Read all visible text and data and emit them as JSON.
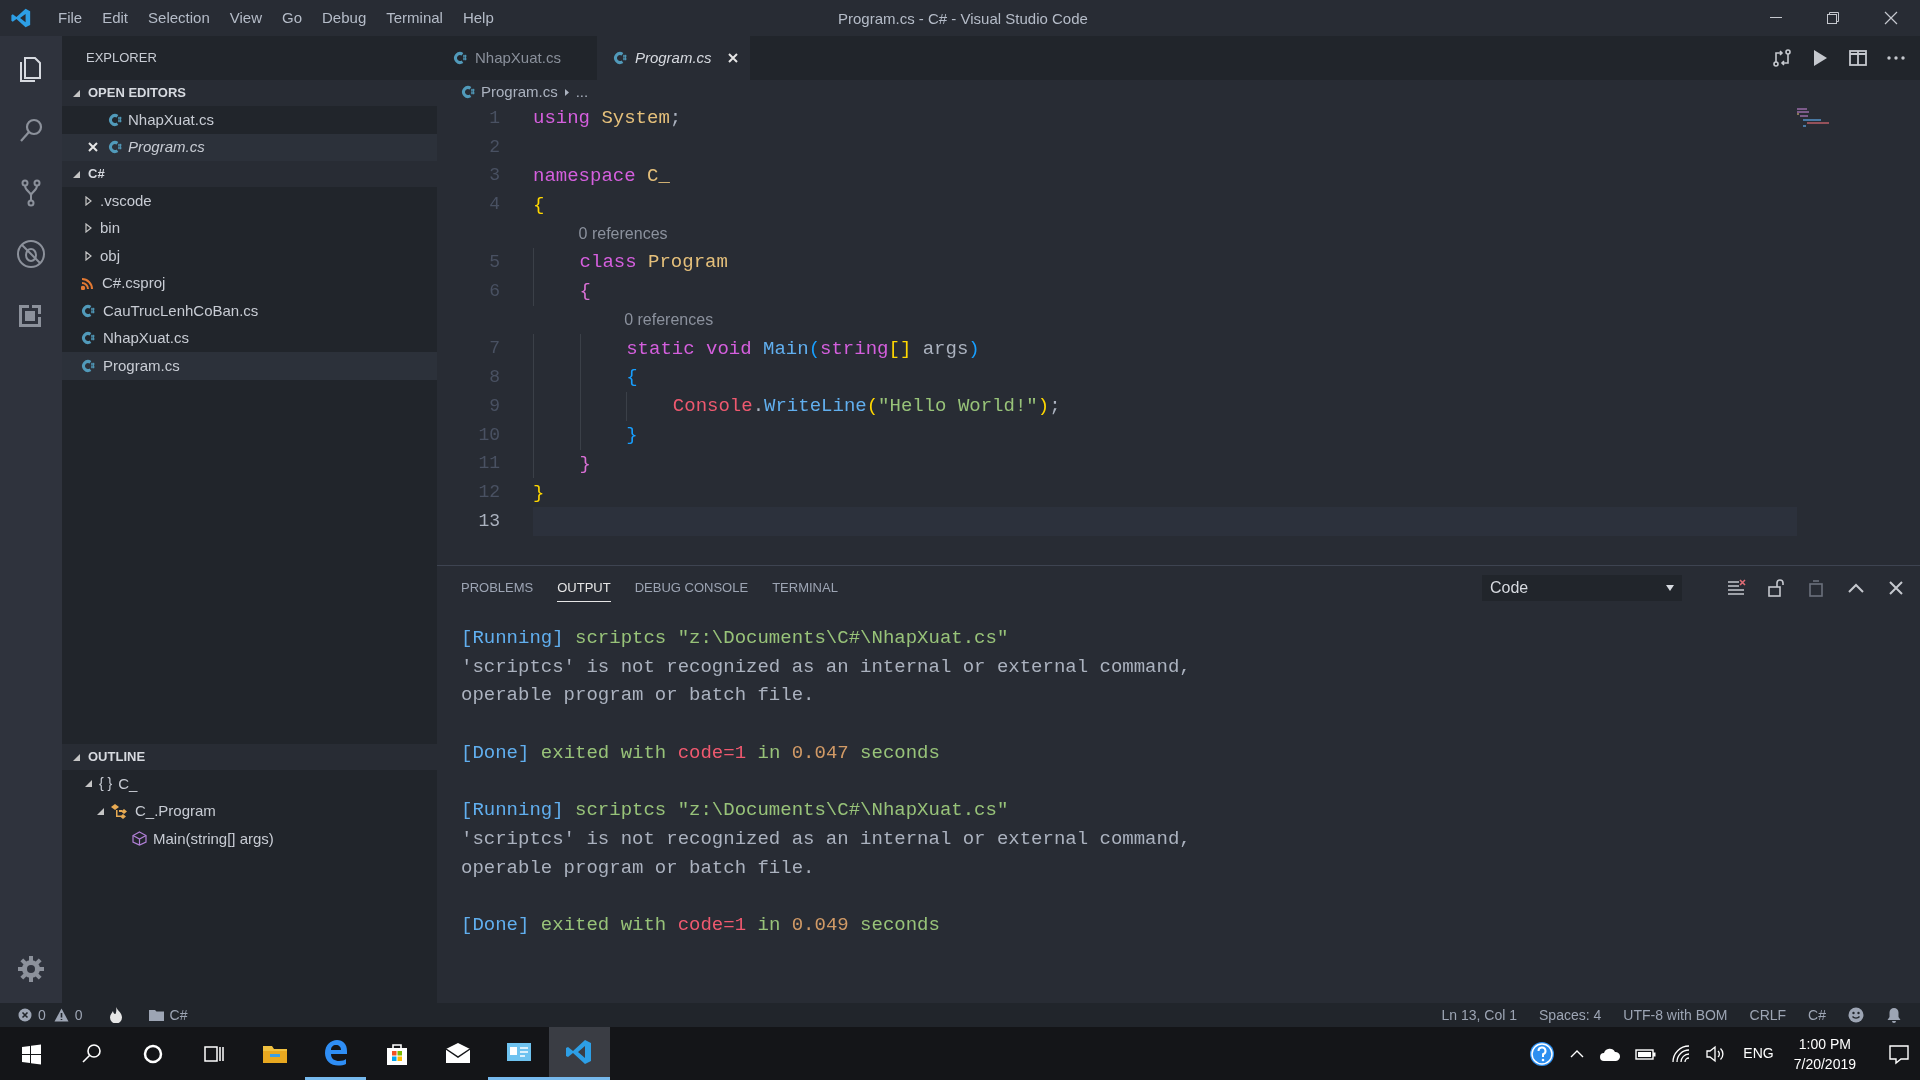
{
  "title_bar": {
    "menu": [
      "File",
      "Edit",
      "Selection",
      "View",
      "Go",
      "Debug",
      "Terminal",
      "Help"
    ],
    "title": "Program.cs - C# - Visual Studio Code"
  },
  "activity_bar": {
    "items": [
      {
        "kind": "files",
        "selected": true
      },
      {
        "kind": "search",
        "selected": false
      },
      {
        "kind": "source-control",
        "selected": false
      },
      {
        "kind": "debug",
        "selected": false
      },
      {
        "kind": "extensions",
        "selected": false
      }
    ]
  },
  "sidebar": {
    "title": "EXPLORER",
    "open_editors": {
      "title": "OPEN EDITORS",
      "expanded": true,
      "items": [
        {
          "name": "NhapXuat.cs",
          "preview": false,
          "selected": false
        },
        {
          "name": "Program.cs",
          "preview": true,
          "selected": true
        }
      ]
    },
    "folder": {
      "title": "C#",
      "expanded": true,
      "items": [
        {
          "name": ".vscode",
          "kind": "folder",
          "expanded": false,
          "selected": false
        },
        {
          "name": "bin",
          "kind": "folder",
          "expanded": false,
          "selected": false
        },
        {
          "name": "obj",
          "kind": "folder",
          "expanded": false,
          "selected": false
        },
        {
          "name": "C#.csproj",
          "kind": "project",
          "selected": false
        },
        {
          "name": "CauTrucLenhCoBan.cs",
          "kind": "csharp",
          "selected": false
        },
        {
          "name": "NhapXuat.cs",
          "kind": "csharp",
          "selected": false
        },
        {
          "name": "Program.cs",
          "kind": "csharp",
          "selected": true
        }
      ]
    },
    "outline": {
      "title": "OUTLINE",
      "expanded": true,
      "items": [
        {
          "name": "C_",
          "kind": "namespace",
          "icon": "{ }",
          "expanded": true,
          "children": [
            {
              "name": "C_.Program",
              "kind": "class",
              "expanded": true,
              "children": [
                {
                  "name": "Main(string[] args)",
                  "kind": "method"
                }
              ]
            }
          ]
        }
      ]
    }
  },
  "editor": {
    "tabs": [
      {
        "name": "NhapXuat.cs",
        "selected": false,
        "preview": false
      },
      {
        "name": "Program.cs",
        "selected": true,
        "preview": true
      }
    ],
    "breadcrumb": [
      "Program.cs",
      "..."
    ],
    "lines": [
      {
        "kind": "code",
        "number": "1",
        "current": false,
        "tokens": [
          {
            "text": "using",
            "kind": "keyword"
          },
          {
            "text": " System",
            "kind": "type"
          },
          {
            "text": ";",
            "kind": "plain"
          }
        ]
      },
      {
        "kind": "code",
        "number": "2",
        "current": false
      },
      {
        "kind": "code",
        "number": "3",
        "current": false,
        "tokens": [
          {
            "text": "namespace",
            "kind": "keyword"
          },
          {
            "text": " C_",
            "kind": "type"
          }
        ]
      },
      {
        "kind": "code",
        "number": "4",
        "current": false,
        "tokens": [
          {
            "text": "{",
            "kind": "brace1"
          }
        ]
      },
      {
        "kind": "codelens",
        "text": "0 references"
      },
      {
        "kind": "code",
        "number": "5",
        "current": false,
        "tokens": [
          {
            "text": "    class",
            "kind": "keyword"
          },
          {
            "text": " Program",
            "kind": "type"
          }
        ]
      },
      {
        "kind": "code",
        "number": "6",
        "current": false,
        "tokens": [
          {
            "text": "    {",
            "kind": "brace2"
          }
        ]
      },
      {
        "kind": "codelens",
        "text": "0 references"
      },
      {
        "kind": "code",
        "number": "7",
        "current": false,
        "tokens": [
          {
            "text": "        static void",
            "kind": "keyword"
          },
          {
            "text": " Main",
            "kind": "function"
          },
          {
            "text": "(",
            "kind": "brace3"
          },
          {
            "text": "string",
            "kind": "keyword"
          },
          {
            "text": "[]",
            "kind": "brace1"
          },
          {
            "text": " args",
            "kind": "plain"
          },
          {
            "text": ")",
            "kind": "brace3"
          }
        ]
      },
      {
        "kind": "code",
        "number": "8",
        "current": false,
        "tokens": [
          {
            "text": "        {",
            "kind": "brace3"
          }
        ]
      },
      {
        "kind": "code",
        "number": "9",
        "current": false,
        "tokens": [
          {
            "text": "            Console",
            "kind": "variable"
          },
          {
            "text": ".",
            "kind": "plain"
          },
          {
            "text": "WriteLine",
            "kind": "function"
          },
          {
            "text": "(",
            "kind": "brace1"
          },
          {
            "text": "\"Hello World!\"",
            "kind": "string"
          },
          {
            "text": ")",
            "kind": "brace1"
          },
          {
            "text": ";",
            "kind": "plain"
          }
        ]
      },
      {
        "kind": "code",
        "number": "10",
        "current": false,
        "tokens": [
          {
            "text": "        }",
            "kind": "brace3"
          }
        ]
      },
      {
        "kind": "code",
        "number": "11",
        "current": false,
        "tokens": [
          {
            "text": "    }",
            "kind": "brace2"
          }
        ]
      },
      {
        "kind": "code",
        "number": "12",
        "current": false,
        "tokens": [
          {
            "text": "}",
            "kind": "brace1"
          }
        ]
      },
      {
        "kind": "code",
        "number": "13",
        "current": true
      }
    ]
  },
  "panel": {
    "tabs": [
      {
        "label": "PROBLEMS",
        "selected": false
      },
      {
        "label": "OUTPUT",
        "selected": true
      },
      {
        "label": "DEBUG CONSOLE",
        "selected": false
      },
      {
        "label": "TERMINAL",
        "selected": false
      }
    ],
    "dropdown": {
      "value": "Code"
    },
    "output": [
      {
        "kind": "text",
        "tokens": [
          {
            "text": "[Running]",
            "kind": "tag"
          },
          {
            "text": " scriptcs \"z:\\Documents\\C#\\NhapXuat.cs\"",
            "kind": "green"
          }
        ]
      },
      {
        "kind": "text",
        "tokens": [
          {
            "text": "'scriptcs' is not recognized as an internal or external command,",
            "kind": "plain"
          }
        ]
      },
      {
        "kind": "text",
        "tokens": [
          {
            "text": "operable program or batch file.",
            "kind": "plain"
          }
        ]
      },
      {
        "kind": "blank"
      },
      {
        "kind": "text",
        "tokens": [
          {
            "text": "[Done]",
            "kind": "tag"
          },
          {
            "text": " exited with ",
            "kind": "green"
          },
          {
            "text": "code=1",
            "kind": "error"
          },
          {
            "text": " in ",
            "kind": "green"
          },
          {
            "text": "0.047",
            "kind": "number"
          },
          {
            "text": " seconds",
            "kind": "green"
          }
        ]
      },
      {
        "kind": "blank"
      },
      {
        "kind": "text",
        "tokens": [
          {
            "text": "[Running]",
            "kind": "tag"
          },
          {
            "text": " scriptcs \"z:\\Documents\\C#\\NhapXuat.cs\"",
            "kind": "green"
          }
        ]
      },
      {
        "kind": "text",
        "tokens": [
          {
            "text": "'scriptcs' is not recognized as an internal or external command,",
            "kind": "plain"
          }
        ]
      },
      {
        "kind": "text",
        "tokens": [
          {
            "text": "operable program or batch file.",
            "kind": "plain"
          }
        ]
      },
      {
        "kind": "blank"
      },
      {
        "kind": "text",
        "tokens": [
          {
            "text": "[Done]",
            "kind": "tag"
          },
          {
            "text": " exited with ",
            "kind": "green"
          },
          {
            "text": "code=1",
            "kind": "error"
          },
          {
            "text": " in ",
            "kind": "green"
          },
          {
            "text": "0.049",
            "kind": "number"
          },
          {
            "text": " seconds",
            "kind": "green"
          }
        ]
      }
    ]
  },
  "status_bar": {
    "errors": "0",
    "warnings": "0",
    "folder": "C#",
    "right": [
      "Ln 13, Col 1",
      "Spaces: 4",
      "UTF-8 with BOM",
      "CRLF",
      "C#"
    ]
  },
  "taskbar": {
    "apps": [
      {
        "kind": "start",
        "running": false,
        "selected": false
      },
      {
        "kind": "search",
        "running": false,
        "selected": false
      },
      {
        "kind": "cortana",
        "running": false,
        "selected": false
      },
      {
        "kind": "task-view",
        "running": false,
        "selected": false
      },
      {
        "kind": "file-explorer",
        "running": false,
        "selected": false
      },
      {
        "kind": "edge",
        "running": true,
        "selected": false
      },
      {
        "kind": "store",
        "running": false,
        "selected": false
      },
      {
        "kind": "mail",
        "running": false,
        "selected": false
      },
      {
        "kind": "app",
        "running": true,
        "selected": false
      },
      {
        "kind": "vscode",
        "running": true,
        "selected": true
      }
    ],
    "language": "ENG",
    "time": "1:00 PM",
    "date": "7/20/2019"
  }
}
